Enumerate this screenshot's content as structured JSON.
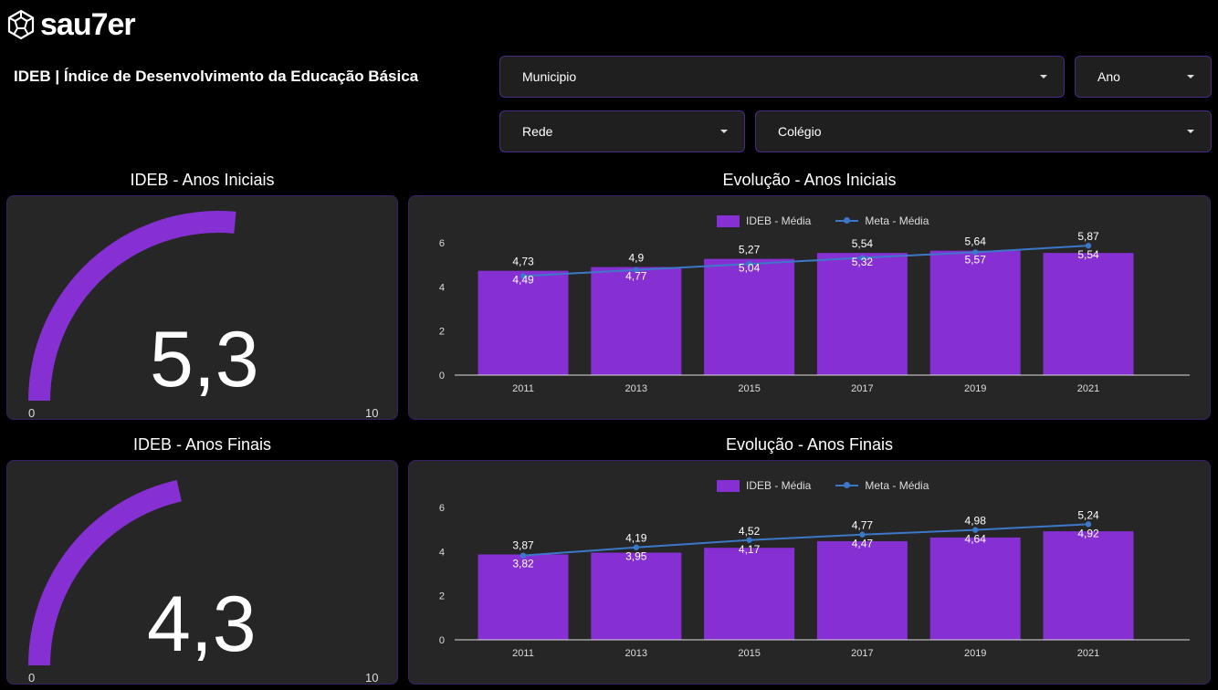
{
  "brand": {
    "name": "sau7er",
    "icon": "geometric-dodecahedron-icon"
  },
  "page": {
    "title": "IDEB | Índice de Desenvolvimento da Educação Básica"
  },
  "filters": {
    "municipio": "Municipio",
    "ano": "Ano",
    "rede": "Rede",
    "colegio": "Colégio"
  },
  "colors": {
    "bar": "#8630d3",
    "line": "#3b78c8",
    "gauge": "#8630d3",
    "panel": "#262626",
    "border": "#3a2068"
  },
  "gauges": {
    "iniciais": {
      "title": "IDEB - Anos Iniciais",
      "value": 5.3,
      "display": "5,3",
      "min": "0",
      "max": "10"
    },
    "finais": {
      "title": "IDEB - Anos Finais",
      "value": 4.3,
      "display": "4,3",
      "min": "0",
      "max": "10"
    }
  },
  "charts": {
    "iniciais": {
      "title": "Evolução - Anos Iniciais"
    },
    "finais": {
      "title": "Evolução - Anos Finais"
    }
  },
  "chart_data": [
    {
      "type": "bar",
      "title": "Evolução - Anos Iniciais",
      "categories": [
        "2011",
        "2013",
        "2015",
        "2017",
        "2019",
        "2021"
      ],
      "ylim": [
        0,
        6
      ],
      "yticks": [
        "0",
        "2",
        "4",
        "6"
      ],
      "grid": false,
      "legend": "top",
      "series": [
        {
          "name": "IDEB - Média",
          "kind": "bar",
          "values": [
            4.73,
            4.9,
            5.27,
            5.54,
            5.64,
            5.54
          ],
          "labels": [
            "4,73",
            "4,9",
            "5,27",
            "5,54",
            "5,64",
            "5,54"
          ]
        },
        {
          "name": "Meta - Média",
          "kind": "line",
          "values": [
            4.49,
            4.77,
            5.04,
            5.32,
            5.57,
            5.87
          ],
          "labels": [
            "4,49",
            "4,77",
            "5,04",
            "5,32",
            "5,57",
            "5,87"
          ]
        }
      ]
    },
    {
      "type": "bar",
      "title": "Evolução - Anos Finais",
      "categories": [
        "2011",
        "2013",
        "2015",
        "2017",
        "2019",
        "2021"
      ],
      "ylim": [
        0,
        6
      ],
      "yticks": [
        "0",
        "2",
        "4",
        "6"
      ],
      "grid": false,
      "legend": "top",
      "series": [
        {
          "name": "IDEB - Média",
          "kind": "bar",
          "values": [
            3.87,
            3.95,
            4.17,
            4.47,
            4.64,
            4.92
          ],
          "labels": [
            "3,87",
            "3,95",
            "4,17",
            "4,47",
            "4,64",
            "4,92"
          ]
        },
        {
          "name": "Meta - Média",
          "kind": "line",
          "values": [
            3.82,
            4.19,
            4.52,
            4.77,
            4.98,
            5.24
          ],
          "labels": [
            "3,82",
            "4,19",
            "4,52",
            "4,77",
            "4,98",
            "5,24"
          ]
        }
      ]
    }
  ]
}
